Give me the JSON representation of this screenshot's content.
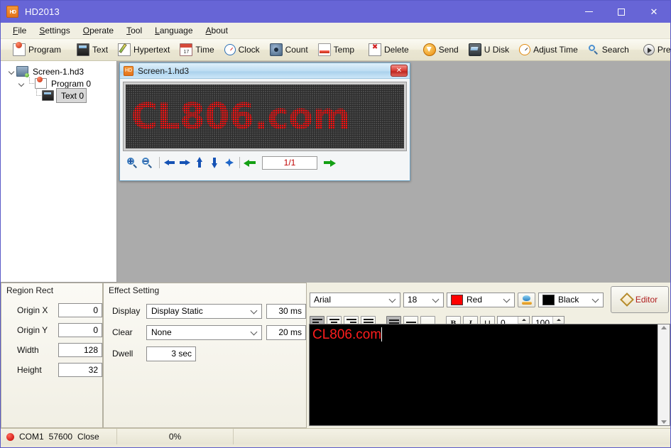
{
  "window": {
    "title": "HD2013",
    "icon": "app-icon",
    "buttons": {
      "minimize": "–",
      "maximize": "☐",
      "close": "×"
    }
  },
  "menubar": {
    "items": [
      {
        "label": "File",
        "accel": "F"
      },
      {
        "label": "Settings",
        "accel": "S"
      },
      {
        "label": "Operate",
        "accel": "O"
      },
      {
        "label": "Tool",
        "accel": "T"
      },
      {
        "label": "Language",
        "accel": "L"
      },
      {
        "label": "About",
        "accel": "A"
      }
    ]
  },
  "toolbar": {
    "groups": [
      {
        "buttons": [
          {
            "label": "Program",
            "icon": "program-icon"
          }
        ]
      },
      {
        "buttons": [
          {
            "label": "Text",
            "icon": "text-icon"
          },
          {
            "label": "Hypertext",
            "icon": "hypertext-icon"
          },
          {
            "label": "Time",
            "icon": "time-icon"
          },
          {
            "label": "Clock",
            "icon": "clock-icon"
          },
          {
            "label": "Count",
            "icon": "count-icon"
          },
          {
            "label": "Temp",
            "icon": "temp-icon"
          }
        ]
      },
      {
        "buttons": [
          {
            "label": "Delete",
            "icon": "delete-icon"
          }
        ]
      },
      {
        "buttons": [
          {
            "label": "Send",
            "icon": "send-icon"
          },
          {
            "label": "U Disk",
            "icon": "udisk-icon"
          },
          {
            "label": "Adjust Time",
            "icon": "adjust-time-icon"
          },
          {
            "label": "Search",
            "icon": "search-icon"
          }
        ]
      },
      {
        "buttons": [
          {
            "label": "Preview",
            "icon": "preview-icon"
          }
        ]
      }
    ]
  },
  "tree": {
    "nodes": [
      {
        "label": "Screen-1.hd3",
        "icon": "screen-icon",
        "level": 0,
        "expanded": true,
        "selected": false
      },
      {
        "label": "Program 0",
        "icon": "program-icon",
        "level": 1,
        "expanded": true,
        "selected": false
      },
      {
        "label": "Text 0",
        "icon": "text-icon",
        "level": 2,
        "expanded": false,
        "selected": true
      }
    ]
  },
  "child_window": {
    "title": "Screen-1.hd3",
    "close_label": "×",
    "led_text": "CL806.com",
    "led_color": "#ff1212",
    "led_bg": "#4a4a4a",
    "nav": {
      "zoom_in": "zoom-in-icon",
      "zoom_out": "zoom-out-icon",
      "left": "move-left-icon",
      "right": "move-right-icon",
      "up": "move-up-icon",
      "down": "move-down-icon",
      "center": "move-center-icon",
      "prev_page": "prev-page-icon",
      "page_indicator": "1/1",
      "next_page": "next-page-icon"
    }
  },
  "region_rect": {
    "title": "Region Rect",
    "fields": [
      {
        "label": "Origin X",
        "value": "0"
      },
      {
        "label": "Origin Y",
        "value": "0"
      },
      {
        "label": "Width",
        "value": "128"
      },
      {
        "label": "Height",
        "value": "32"
      }
    ]
  },
  "effect_setting": {
    "title": "Effect Setting",
    "display": {
      "label": "Display",
      "value": "Display Static",
      "speed": "30 ms"
    },
    "clear": {
      "label": "Clear",
      "value": "None",
      "speed": "20 ms"
    },
    "dwell": {
      "label": "Dwell",
      "value": "3 sec"
    }
  },
  "editor": {
    "font": {
      "value": "Arial"
    },
    "size": {
      "value": "18"
    },
    "fore_color": {
      "value": "Red",
      "swatch": "#ff0000"
    },
    "fill_button": "fill-color-icon",
    "back_color": {
      "value": "Black",
      "swatch": "#000000"
    },
    "editor_button": {
      "label": "Editor",
      "icon": "diamond-icon"
    },
    "align_h": [
      {
        "name": "align-left",
        "active": true
      },
      {
        "name": "align-center",
        "active": false
      },
      {
        "name": "align-right",
        "active": false
      },
      {
        "name": "align-justify",
        "active": false
      }
    ],
    "align_v": [
      {
        "name": "align-top",
        "active": true
      },
      {
        "name": "align-middle",
        "active": false
      },
      {
        "name": "align-bottom",
        "active": false
      }
    ],
    "style": [
      {
        "name": "bold",
        "label": "B"
      },
      {
        "name": "italic",
        "label": "I"
      },
      {
        "name": "underline",
        "label": "U"
      }
    ],
    "spin_left": {
      "value": "0"
    },
    "spin_right": {
      "value": "100"
    },
    "text_value": "CL806.com",
    "text_color": "#ff1d1d"
  },
  "statusbar": {
    "port": "COM1",
    "baud": "57600",
    "state": "Close",
    "progress": "0%",
    "extra": ""
  }
}
